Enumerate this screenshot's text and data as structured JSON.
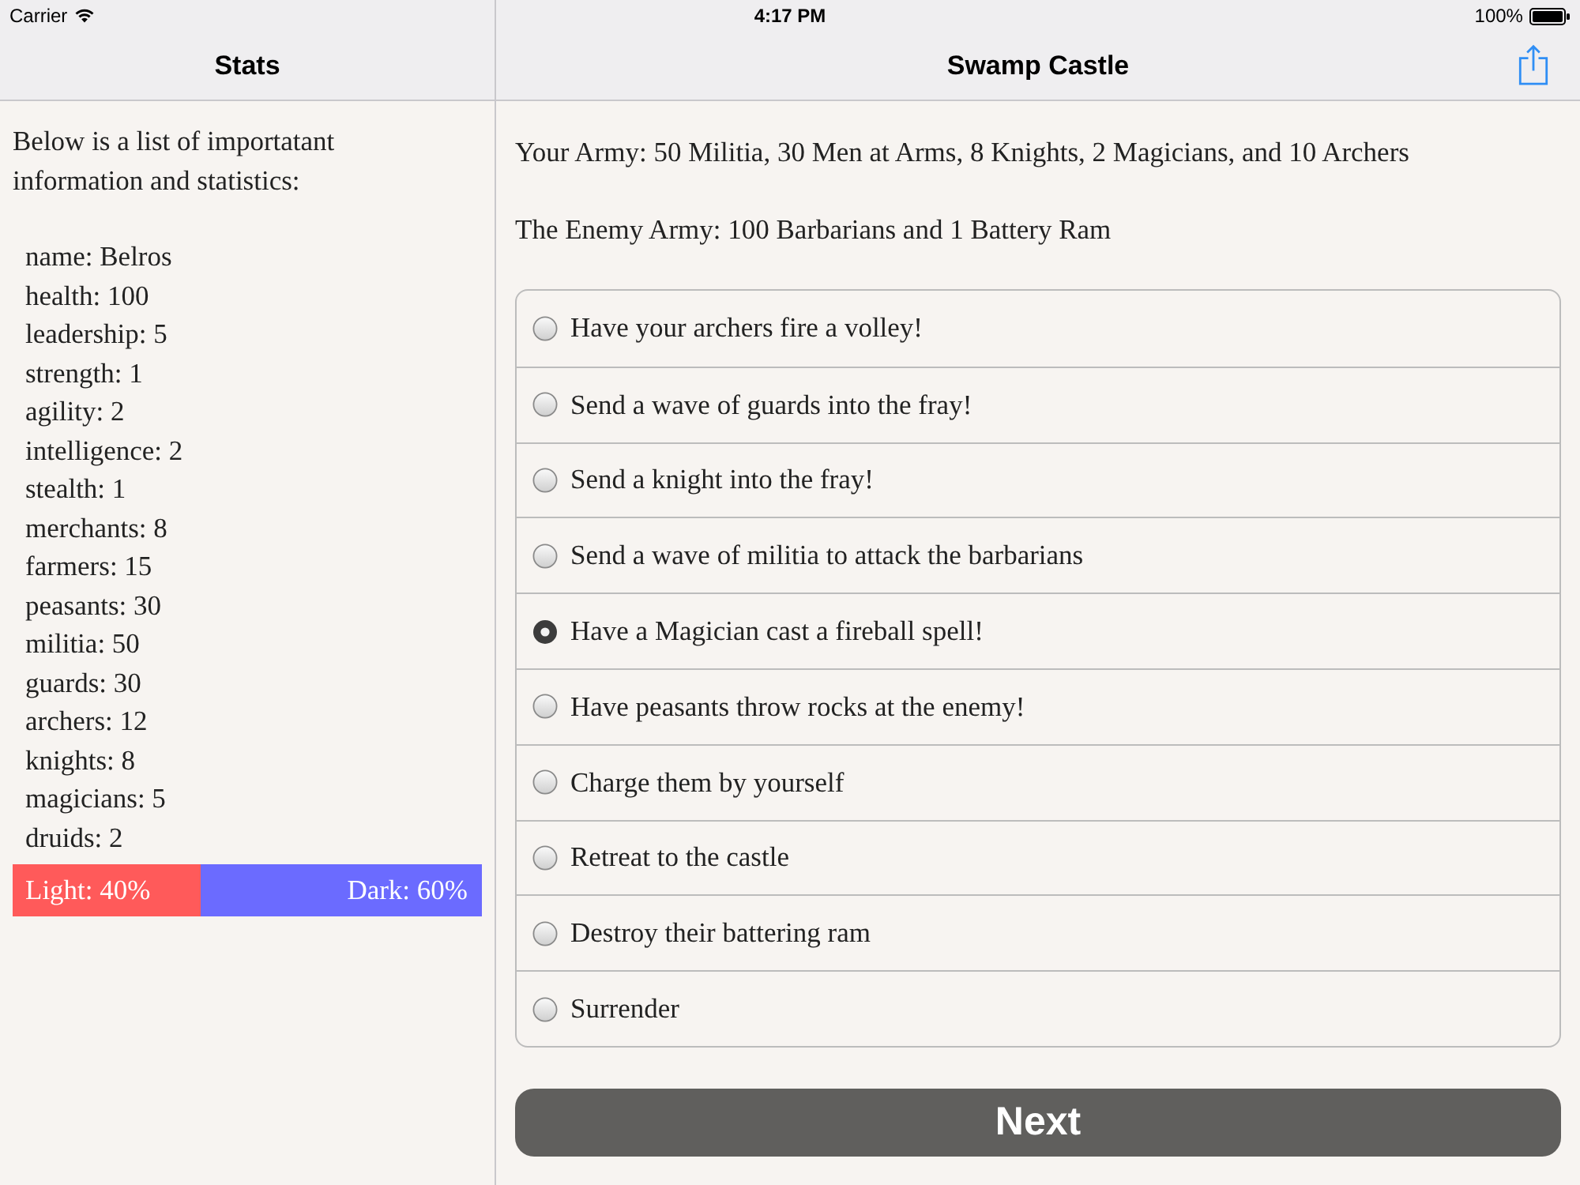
{
  "status_bar": {
    "carrier": "Carrier",
    "time": "4:17 PM",
    "battery": "100%"
  },
  "sidebar": {
    "title": "Stats",
    "intro": "Below is a list of importatant information and statistics:",
    "stats": [
      "name: Belros",
      "health: 100",
      "leadership: 5",
      "strength: 1",
      "agility: 2",
      "intelligence: 2",
      "stealth: 1",
      "merchants: 8",
      "farmers: 15",
      "peasants: 30",
      "militia: 50",
      "guards: 30",
      "archers: 12",
      "knights: 8",
      "magicians: 5",
      "druids: 2"
    ],
    "alignment_bar": {
      "level": 0.4,
      "light_label": "Light: 40%",
      "dark_label": "Dark: 60%"
    }
  },
  "main": {
    "title": "Swamp Castle",
    "your_army": "Your Army: 50 Militia, 30 Men at Arms, 8 Knights, 2 Magicians, and 10 Archers",
    "enemy_army": "The Enemy Army: 100 Barbarians and 1 Battery Ram",
    "options": [
      {
        "label": "Have your archers fire a volley!",
        "selected": false
      },
      {
        "label": "Send a wave of guards into the fray!",
        "selected": false
      },
      {
        "label": "Send a knight into the fray!",
        "selected": false
      },
      {
        "label": "Send a wave of militia to attack the barbarians",
        "selected": false
      },
      {
        "label": "Have a Magician cast a fireball spell!",
        "selected": true
      },
      {
        "label": "Have peasants throw rocks at the enemy!",
        "selected": false
      },
      {
        "label": "Charge them by yourself",
        "selected": false
      },
      {
        "label": "Retreat to the castle",
        "selected": false
      },
      {
        "label": "Destroy their battering ram",
        "selected": false
      },
      {
        "label": "Surrender",
        "selected": false
      }
    ],
    "next_button": "Next"
  }
}
